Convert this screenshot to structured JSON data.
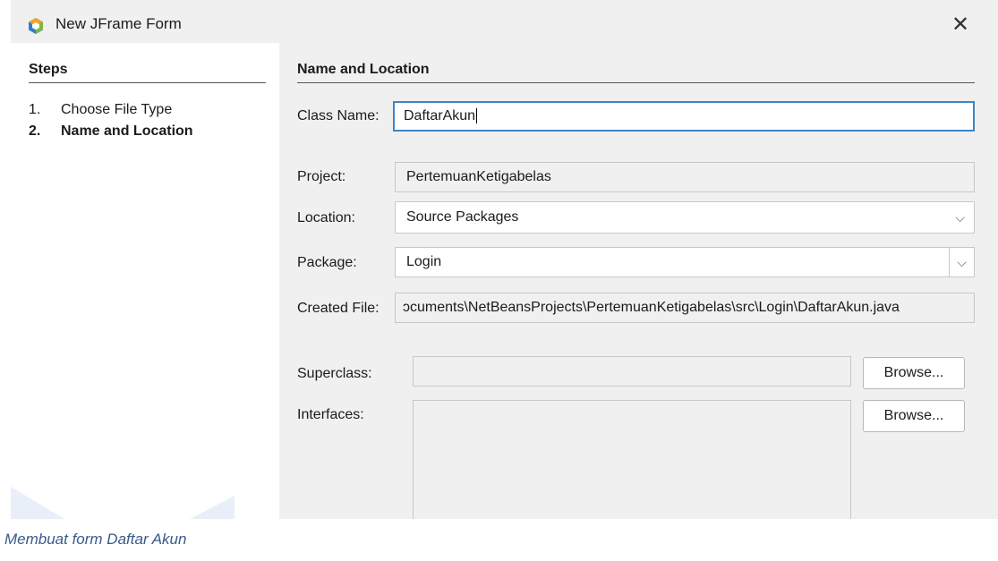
{
  "window": {
    "title": "New JFrame Form",
    "app_icon": "netbeans-cube-icon",
    "close_glyph": "✕"
  },
  "steps": {
    "title": "Steps",
    "items": [
      {
        "num": "1.",
        "label": "Choose File Type"
      },
      {
        "num": "2.",
        "label": "Name and Location"
      }
    ]
  },
  "main": {
    "title": "Name and Location",
    "class_name_label": "Class Name:",
    "class_name_value": "DaftarAkun",
    "project_label": "Project:",
    "project_value": "PertemuanKetigabelas",
    "location_label": "Location:",
    "location_value": "Source Packages",
    "package_label": "Package:",
    "package_value": "Login",
    "created_file_label": "Created File:",
    "created_file_value": "ɔcuments\\NetBeansProjects\\PertemuanKetigabelas\\src\\Login\\DaftarAkun.java",
    "superclass_label": "Superclass:",
    "superclass_value": "",
    "interfaces_label": "Interfaces:",
    "browse_label": "Browse...",
    "dropdown_glyph": "⌵"
  },
  "caption": "Membuat form Daftar Akun",
  "colors": {
    "accent": "#3d85c6",
    "caption": "#3a5a8a",
    "dialog_bg": "#f0f0f0"
  }
}
